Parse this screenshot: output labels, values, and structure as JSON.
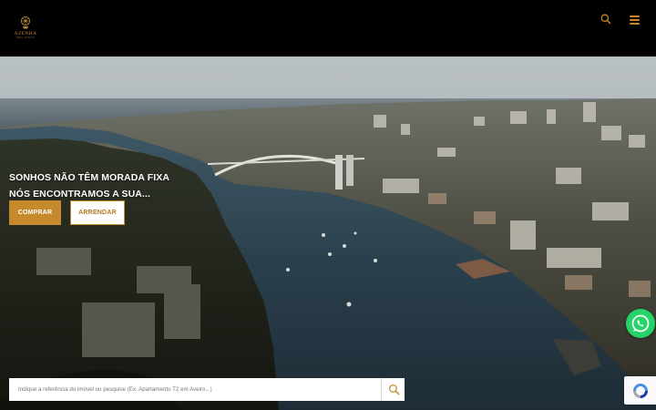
{
  "header": {
    "logo": {
      "name": "AZENHA",
      "subtitle": "REAL ESTATE",
      "brand_color": "#b8893a"
    },
    "search_icon": "search-icon",
    "menu_icon": "hamburger-menu-icon",
    "accent_color": "#c9892a"
  },
  "hero": {
    "background": "aerial-photo-porto-douro-river-arrabida-bridge",
    "headline_line1": "SONHOS NÃO TÊM MORADA FIXA",
    "headline_line2": "NÓS ENCONTRAMOS A SUA...",
    "buttons": {
      "buy_label": "COMPRAR",
      "rent_label": "ARRENDAR"
    }
  },
  "search": {
    "placeholder": "Indique a referência do imóvel ou pesquise (Ex. Apartamento T2 em Aveiro...)",
    "submit_icon": "search-icon"
  },
  "floating": {
    "whatsapp_icon": "whatsapp-icon",
    "whatsapp_color": "#25d366",
    "recaptcha_icon": "recaptcha-icon"
  }
}
